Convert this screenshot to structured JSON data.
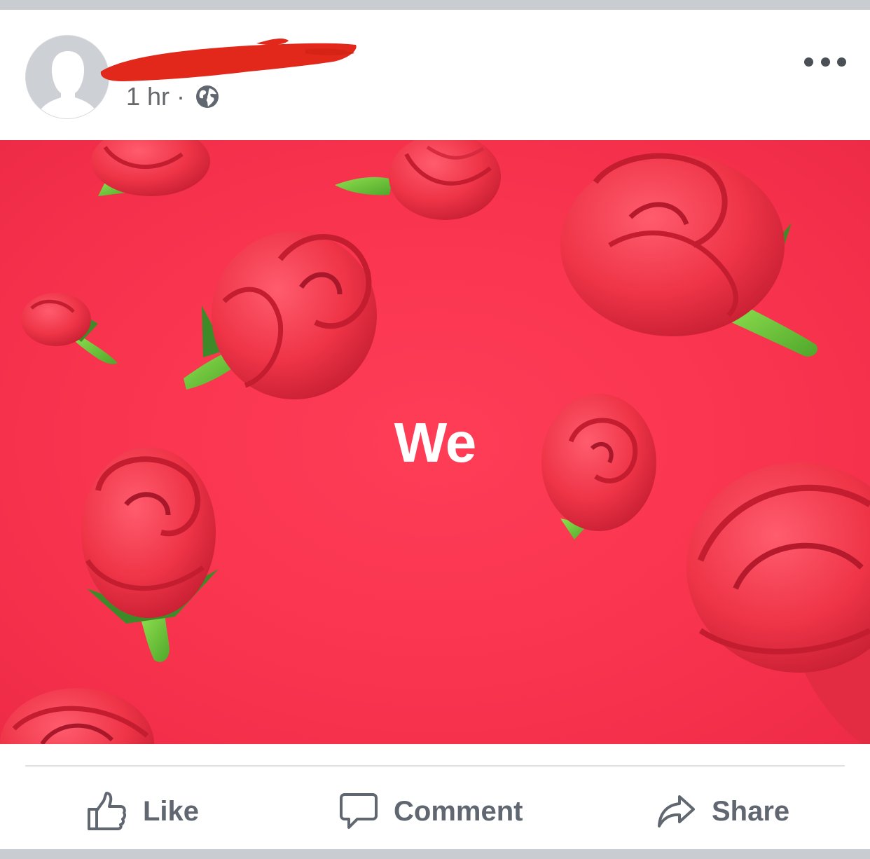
{
  "post": {
    "timestamp": "1 hr",
    "separator": "·",
    "privacy_icon": "globe-icon",
    "menu_icon": "more-icon",
    "avatar_icon": "default-avatar"
  },
  "media": {
    "overlay_text": "We",
    "background_color": "#f8334e",
    "subject": "roses"
  },
  "actions": {
    "like_label": "Like",
    "comment_label": "Comment",
    "share_label": "Share"
  },
  "colors": {
    "redaction": "#e2281a",
    "action_text": "#606770",
    "meta_text": "#65676b"
  }
}
